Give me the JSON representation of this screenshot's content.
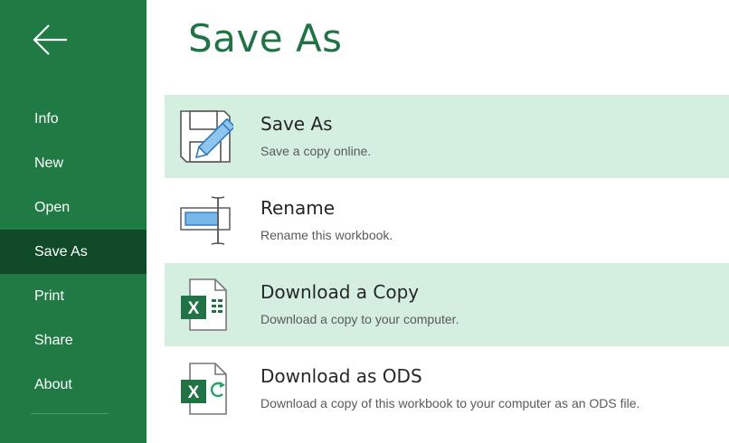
{
  "colors": {
    "sidebar": "#1f7a44",
    "sidebar_active": "#114a28",
    "title": "#217346",
    "highlight": "#d4efe0"
  },
  "sidebar": {
    "back_icon": "arrow-left-icon",
    "items": [
      {
        "label": "Info"
      },
      {
        "label": "New"
      },
      {
        "label": "Open"
      },
      {
        "label": "Save As",
        "active": true
      },
      {
        "label": "Print"
      },
      {
        "label": "Share"
      },
      {
        "label": "About"
      }
    ]
  },
  "main": {
    "title": "Save As",
    "options": [
      {
        "title": "Save As",
        "description": "Save a copy online.",
        "icon": "floppy-pencil-icon",
        "highlighted": true
      },
      {
        "title": "Rename",
        "description": "Rename this workbook.",
        "icon": "rename-icon",
        "highlighted": false
      },
      {
        "title": "Download a Copy",
        "description": "Download a copy to your computer.",
        "icon": "excel-file-icon",
        "highlighted": true
      },
      {
        "title": "Download as ODS",
        "description": "Download a copy of this workbook to your computer as an ODS file.",
        "icon": "excel-ods-file-icon",
        "highlighted": false
      }
    ]
  }
}
